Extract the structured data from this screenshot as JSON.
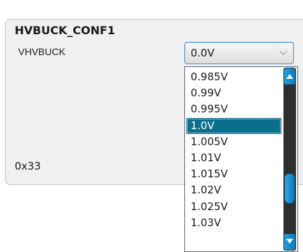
{
  "panel": {
    "title": "HVBUCK_CONF1",
    "field_label": "VHVBUCK",
    "hex_value": "0x33"
  },
  "combo": {
    "selected_value": "0.0V",
    "icon": "chevron-down-icon"
  },
  "dropdown": {
    "items": [
      {
        "label": "0.985V",
        "selected": false
      },
      {
        "label": "0.99V",
        "selected": false
      },
      {
        "label": "0.995V",
        "selected": false
      },
      {
        "label": "1.0V",
        "selected": true
      },
      {
        "label": "1.005V",
        "selected": false
      },
      {
        "label": "1.01V",
        "selected": false
      },
      {
        "label": "1.015V",
        "selected": false
      },
      {
        "label": "1.02V",
        "selected": false
      },
      {
        "label": "1.025V",
        "selected": false
      },
      {
        "label": "1.03V",
        "selected": false
      }
    ]
  },
  "colors": {
    "selected_bg": "#0b6f8c",
    "accent": "#1fa0e0",
    "scrollbar_track": "#2f2f2f"
  }
}
